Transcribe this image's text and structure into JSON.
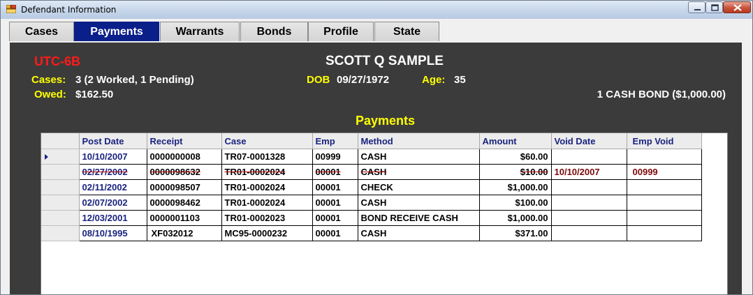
{
  "window": {
    "title": "Defendant Information"
  },
  "tabs": [
    {
      "label": "Cases",
      "active": false
    },
    {
      "label": "Payments",
      "active": true
    },
    {
      "label": "Warrants",
      "active": false
    },
    {
      "label": "Bonds",
      "active": false
    },
    {
      "label": "Profile",
      "active": false
    },
    {
      "label": "State",
      "active": false
    }
  ],
  "header": {
    "court_code": "UTC-6B",
    "defendant_name": "SCOTT Q SAMPLE",
    "cases_label": "Cases:",
    "cases_value": "3 (2 Worked, 1 Pending)",
    "owed_label": "Owed:",
    "owed_value": "$162.50",
    "dob_label": "DOB",
    "dob_value": "09/27/1972",
    "age_label": "Age:",
    "age_value": "35",
    "bond_summary": "1 CASH BOND ($1,000.00)"
  },
  "payments": {
    "section_title": "Payments",
    "columns": [
      "Post Date",
      "Receipt",
      "Case",
      "Emp",
      "Method",
      "Amount",
      "Void Date",
      "Emp Void"
    ],
    "rows": [
      {
        "post_date": "10/10/2007",
        "receipt": "0000000008",
        "case": "TR07-0001328",
        "emp": "00999",
        "method": "CASH",
        "amount": "$60.00",
        "void_date": "",
        "emp_void": "",
        "voided": false,
        "current": true
      },
      {
        "post_date": "02/27/2002",
        "receipt": "0000098632",
        "case": "TR01-0002024",
        "emp": "00001",
        "method": "CASH",
        "amount": "$10.00",
        "void_date": "10/10/2007",
        "emp_void": "00999",
        "voided": true,
        "current": false
      },
      {
        "post_date": "02/11/2002",
        "receipt": "0000098507",
        "case": "TR01-0002024",
        "emp": "00001",
        "method": "CHECK",
        "amount": "$1,000.00",
        "void_date": "",
        "emp_void": "",
        "voided": false,
        "current": false
      },
      {
        "post_date": "02/07/2002",
        "receipt": "0000098462",
        "case": "TR01-0002024",
        "emp": "00001",
        "method": "CASH",
        "amount": "$100.00",
        "void_date": "",
        "emp_void": "",
        "voided": false,
        "current": false
      },
      {
        "post_date": "12/03/2001",
        "receipt": "0000001103",
        "case": "TR01-0002023",
        "emp": "00001",
        "method": "BOND RECEIVE CASH",
        "amount": "$1,000.00",
        "void_date": "",
        "emp_void": "",
        "voided": false,
        "current": false
      },
      {
        "post_date": "08/10/1995",
        "receipt": "XF032012",
        "case": "MC95-0000232",
        "emp": "00001",
        "method": "CASH",
        "amount": "$371.00",
        "void_date": "",
        "emp_void": "",
        "voided": false,
        "current": false
      }
    ]
  },
  "colors": {
    "active_tab": "#0b1f8a",
    "panel_bg": "#3b3b3b",
    "label_yellow": "#ffff00",
    "court_code_red": "#ff1a1a",
    "header_text_navy": "#1a237e",
    "void_text": "#7a0a0a"
  },
  "icons": [
    "app-icon",
    "minimize-icon",
    "maximize-icon",
    "close-icon",
    "row-pointer-icon"
  ]
}
